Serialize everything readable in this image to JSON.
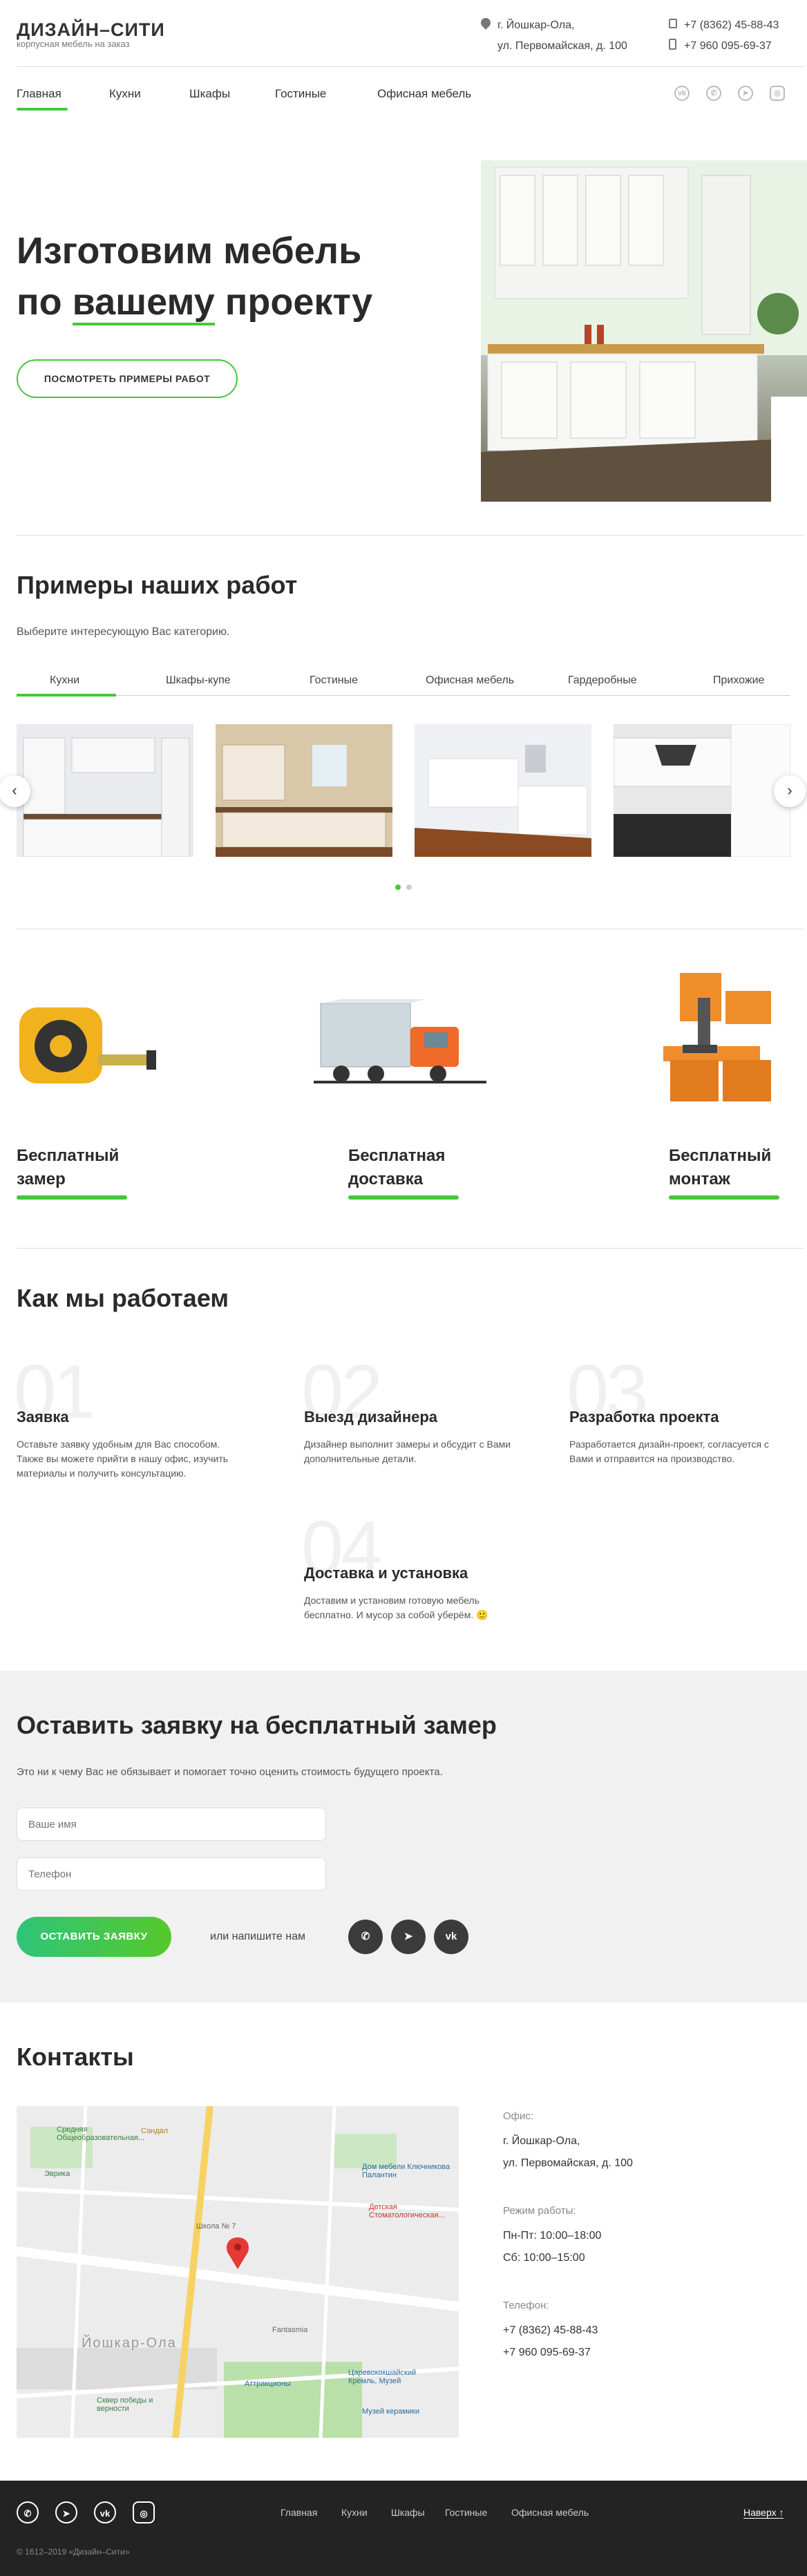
{
  "header": {
    "logo_title": "ДИЗАЙН–СИТИ",
    "logo_sub": "корпусная мебель на заказ",
    "address_line1": "г. Йошкар-Ола,",
    "address_line2": "ул. Первомайская, д. 100",
    "phone1": "+7 (8362) 45-88-43",
    "phone2": "+7 960 095-69-37"
  },
  "nav": [
    "Главная",
    "Кухни",
    "Шкафы",
    "Гостиные",
    "Офисная мебель"
  ],
  "social_top": [
    "vk-icon",
    "whatsapp-icon",
    "telegram-icon",
    "instagram-icon"
  ],
  "hero": {
    "title_line1": "Изготовим мебель",
    "title_line2_pre": "по ",
    "title_line2_u": "вашему",
    "title_line2_post": " проекту",
    "button": "ПОСМОТРЕТЬ ПРИМЕРЫ РАБОТ"
  },
  "works": {
    "title": "Примеры наших работ",
    "subtitle": "Выберите интересующую Вас категорию.",
    "tabs": [
      "Кухни",
      "Шкафы-купе",
      "Гостиные",
      "Офисная мебель",
      "Гардеробные",
      "Прихожие"
    ]
  },
  "features": [
    "Бесплатный замер",
    "Бесплатная доставка",
    "Бесплатный монтаж"
  ],
  "how": {
    "title": "Как мы работаем",
    "steps": [
      {
        "num": "01",
        "title": "Заявка",
        "text": "Оставьте заявку удобным для Вас способом. Также вы можете прийти в нашу офис, изучить материалы и получить консультацию."
      },
      {
        "num": "02",
        "title": "Выезд дизайнера",
        "text": "Дизайнер выполнит замеры и обсудит с Вами дополнительные детали."
      },
      {
        "num": "03",
        "title": "Разработка проекта",
        "text": "Разработается дизайн-проект, согласуется с Вами и отправится на производство."
      },
      {
        "num": "04",
        "title": "Доставка и установка",
        "text": "Доставим и установим готовую мебель бесплатно. И мусор за собой уберём. 🙂"
      }
    ]
  },
  "form": {
    "title": "Оставить заявку на бесплатный замер",
    "subtitle": "Это ни к чему Вас не обязывает и помогает точно оценить стоимость будущего проекта.",
    "name_placeholder": "Ваше имя",
    "phone_placeholder": "Телефон",
    "submit": "ОСТАВИТЬ ЗАЯВКУ",
    "or_text": "или напишите нам"
  },
  "contacts": {
    "title": "Контакты",
    "office_label": "Офис:",
    "office_line1": "г. Йошкар-Ола,",
    "office_line2": "ул. Первомайская, д. 100",
    "hours_label": "Режим работы:",
    "hours_line1": "Пн-Пт: 10:00–18:00",
    "hours_line2": "Сб: 10:00–15:00",
    "phone_label": "Телефон:",
    "phone1": "+7 (8362) 45-88-43",
    "phone2": "+7 960 095-69-37",
    "map_city": "Йошкар-Ола",
    "map_labels": [
      "Сандал",
      "Эврика",
      "Средняя Общеобразовательная...",
      "Дом мебели Ключникова Палантин",
      "Детская Стоматологическая...",
      "Школа № 7",
      "Fantasmia",
      "Аттракционы",
      "Царевококшайский Кремль, Музей",
      "Музей керамики",
      "Сквер победы и верности"
    ]
  },
  "footer": {
    "nav": [
      "Главная",
      "Кухни",
      "Шкафы",
      "Гостиные",
      "Офисная мебель"
    ],
    "up": "Наверх ↑",
    "copyright": "© 1612–2019 «Дизайн–Сити»"
  },
  "colors": {
    "accent": "#43c83b",
    "dark": "#232323"
  }
}
